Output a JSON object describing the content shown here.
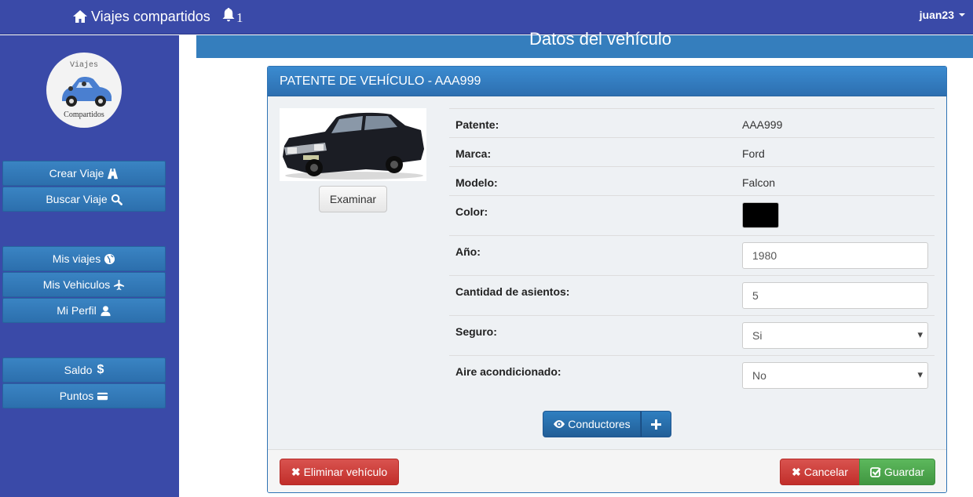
{
  "navbar": {
    "brand": "Viajes compartidos",
    "notifications_count": "1",
    "user": "juan23"
  },
  "sidebar": {
    "logo_top": "Viajes",
    "logo_bottom": "Compartidos",
    "items": [
      {
        "label": "Crear Viaje",
        "icon": "road-icon"
      },
      {
        "label": "Buscar Viaje",
        "icon": "search-icon"
      },
      {
        "label": "Mis viajes",
        "icon": "globe-icon"
      },
      {
        "label": "Mis Vehiculos",
        "icon": "plane-icon"
      },
      {
        "label": "Mi Perfil",
        "icon": "user-icon"
      },
      {
        "label": "Saldo",
        "icon": "dollar-icon"
      },
      {
        "label": "Puntos",
        "icon": "credit-card-icon"
      }
    ]
  },
  "page": {
    "title": "Datos del vehículo"
  },
  "panel": {
    "heading": "PATENTE DE VEHÍCULO - AAA999",
    "examinar_label": "Examinar",
    "rows": {
      "patente": {
        "label": "Patente:",
        "value": "AAA999"
      },
      "marca": {
        "label": "Marca:",
        "value": "Ford"
      },
      "modelo": {
        "label": "Modelo:",
        "value": "Falcon"
      },
      "color": {
        "label": "Color:",
        "value": "#000000"
      },
      "anio": {
        "label": "Año:",
        "value": "1980"
      },
      "asientos": {
        "label": "Cantidad de asientos:",
        "value": "5"
      },
      "seguro": {
        "label": "Seguro:",
        "value": "Si"
      },
      "aire": {
        "label": "Aire acondicionado:",
        "value": "No"
      }
    },
    "conductores_label": "Conductores",
    "footer": {
      "eliminar_label": "Eliminar vehículo",
      "cancelar_label": "Cancelar",
      "guardar_label": "Guardar"
    }
  },
  "colors": {
    "navbar": "#3a4aa8",
    "primary": "#2f73b4",
    "danger": "#d9534f",
    "success": "#5cb85c"
  }
}
